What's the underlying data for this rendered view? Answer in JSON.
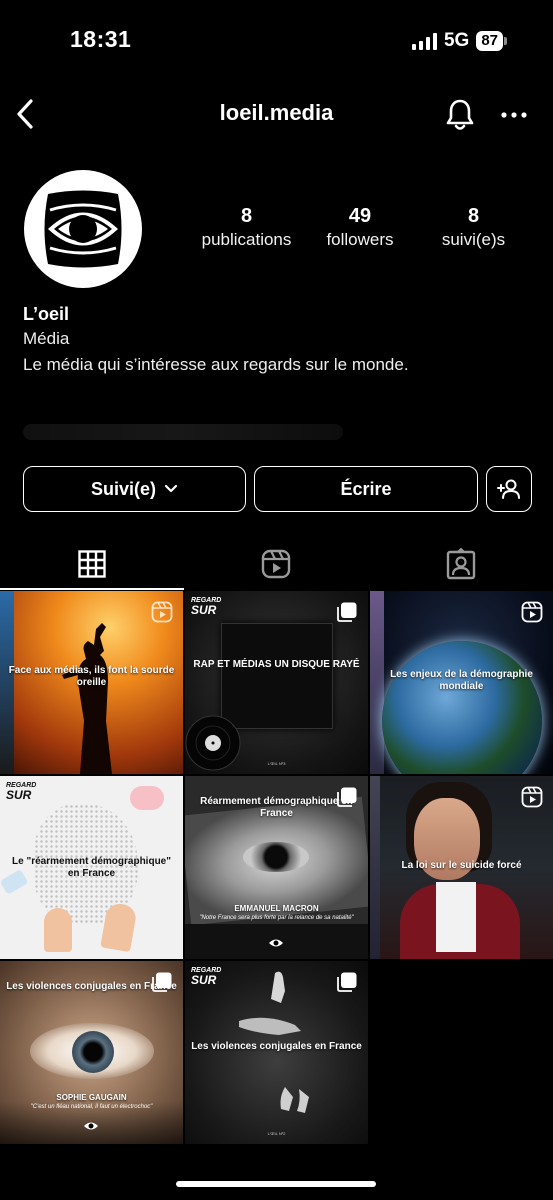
{
  "status_bar": {
    "time": "18:31",
    "network": "5G",
    "battery": "87"
  },
  "header": {
    "username": "loeil.media"
  },
  "profile": {
    "stats": [
      {
        "value": "8",
        "label": "publications"
      },
      {
        "value": "49",
        "label": "followers"
      },
      {
        "value": "8",
        "label": "suivi(e)s"
      }
    ],
    "name": "L’oeil",
    "category": "Média",
    "bio": "Le média qui s’intéresse aux regards sur le monde."
  },
  "actions": {
    "follow_label": "Suivi(e)",
    "message_label": "Écrire"
  },
  "tabs": [
    "grid-icon",
    "reels-icon",
    "tagged-icon"
  ],
  "posts": [
    {
      "caption": "Face aux médias, ils font la sourde oreille",
      "type": "reel"
    },
    {
      "caption": "RAP ET MÉDIAS UN DISQUE RAYÉ",
      "type": "carousel",
      "tag_small": "REGARD",
      "tag_big": "SUR",
      "footer": "L'ŒIL Nº3"
    },
    {
      "caption": "Les enjeux de la démographie mondiale",
      "type": "reel"
    },
    {
      "caption": "Le \"réarmement démographique\" en France",
      "type": "none",
      "tag_small": "REGARD",
      "tag_big": "SUR"
    },
    {
      "caption": "Réarmement démographique en France",
      "type": "carousel",
      "name": "EMMANUEL MACRON",
      "quote": "\"Notre France sera plus forte par la relance de sa natalité\""
    },
    {
      "caption": "La loi sur le suicide forcé",
      "type": "reel"
    },
    {
      "caption": "Les violences conjugales en France",
      "type": "carousel",
      "name": "SOPHIE GAUGAIN",
      "quote": "\"C'est un fléau national, il faut un électrochoc\""
    },
    {
      "caption": "Les violences conjugales en France",
      "type": "carousel",
      "tag_small": "REGARD",
      "tag_big": "SUR",
      "footer": "L'ŒIL Nº2"
    }
  ]
}
